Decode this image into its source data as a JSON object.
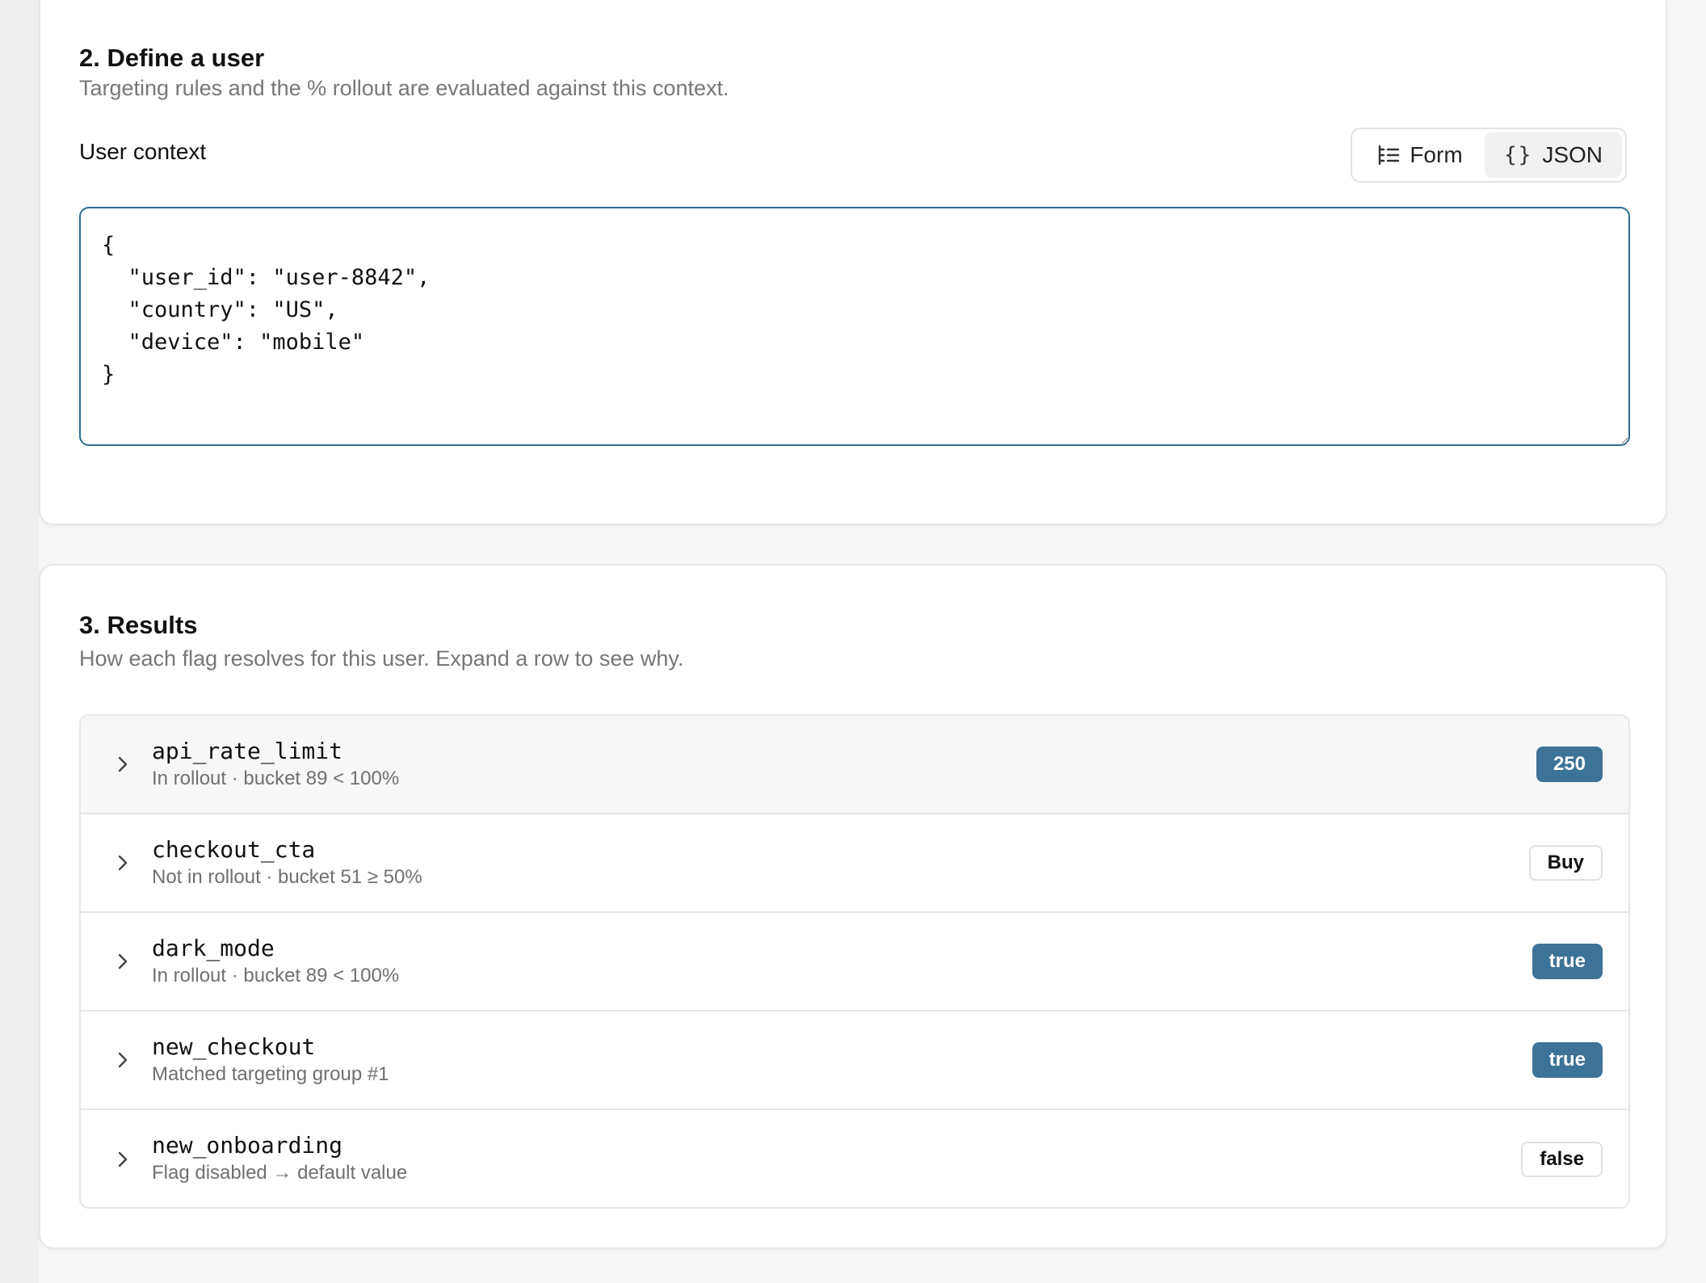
{
  "define_user": {
    "title": "2. Define a user",
    "subtitle": "Targeting rules and the % rollout are evaluated against this context.",
    "context_label": "User context",
    "mode_toggle": {
      "form_label": "Form",
      "json_label": "JSON",
      "selected": "JSON",
      "form_icon": "list-tree-icon",
      "json_icon": "braces-icon"
    },
    "json_value": "{\n  \"user_id\": \"user-8842\",\n  \"country\": \"US\",\n  \"device\": \"mobile\"\n}"
  },
  "results": {
    "title": "3. Results",
    "subtitle": "How each flag resolves for this user. Expand a row to see why.",
    "rows": [
      {
        "name": "api_rate_limit",
        "reason": "In rollout · bucket 89 < 100%",
        "value": "250",
        "style": "filled"
      },
      {
        "name": "checkout_cta",
        "reason": "Not in rollout · bucket 51 ≥ 50%",
        "value": "Buy",
        "style": "outline"
      },
      {
        "name": "dark_mode",
        "reason": "In rollout · bucket 89 < 100%",
        "value": "true",
        "style": "filled"
      },
      {
        "name": "new_checkout",
        "reason": "Matched targeting group #1",
        "value": "true",
        "style": "filled"
      },
      {
        "name": "new_onboarding",
        "reason": "Flag disabled → default value",
        "value": "false",
        "style": "outline"
      }
    ]
  },
  "colors": {
    "accent": "#3d7396",
    "focus_border": "#2d6b8f",
    "muted_text": "#777777"
  }
}
